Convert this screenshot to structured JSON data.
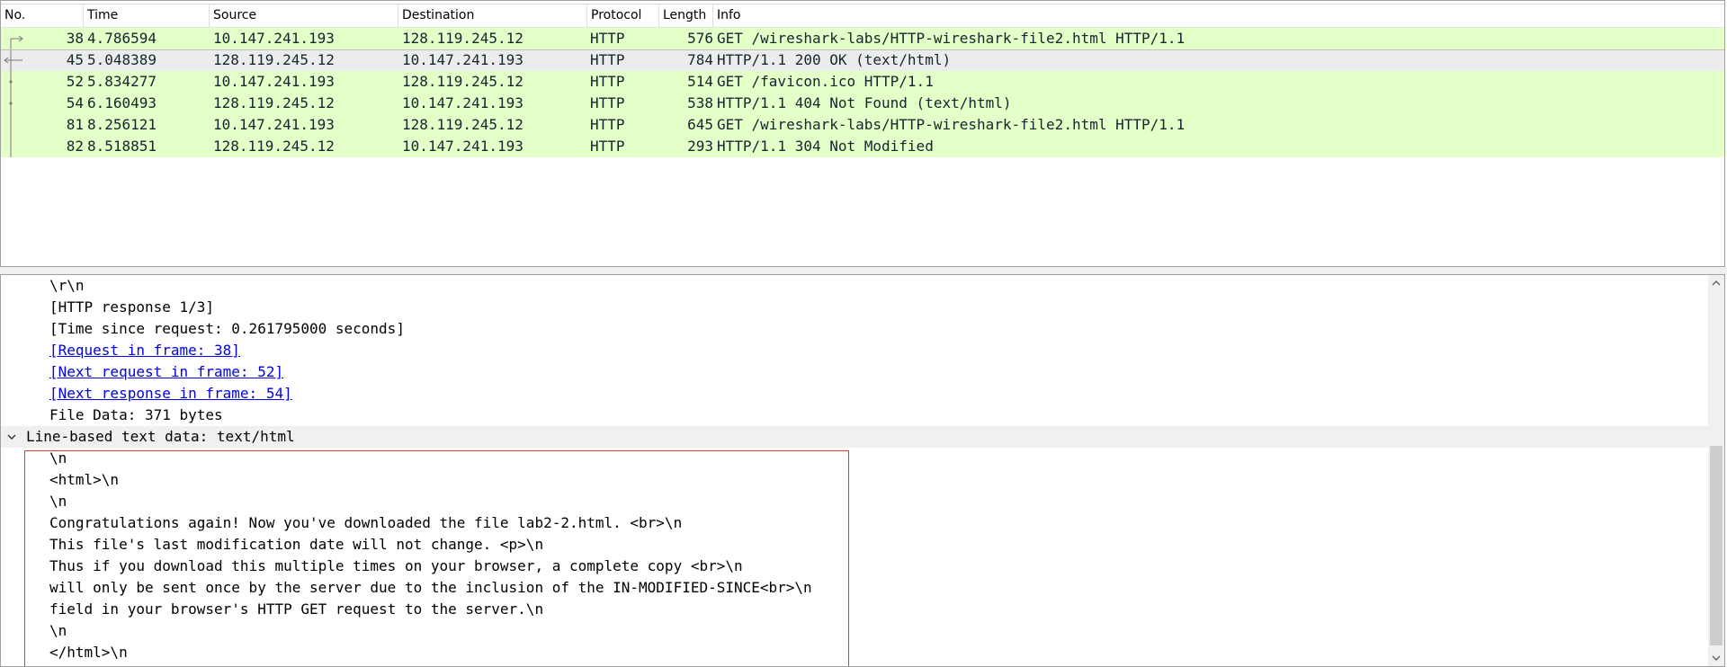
{
  "packet_list": {
    "columns": [
      "No.",
      "Time",
      "Source",
      "Destination",
      "Protocol",
      "Length",
      "Info"
    ],
    "rows": [
      {
        "no": "38",
        "time": "4.786594",
        "src": "10.147.241.193",
        "dst": "128.119.245.12",
        "proto": "HTTP",
        "len": "576",
        "info": "GET /wireshark-labs/HTTP-wireshark-file2.html HTTP/1.1"
      },
      {
        "no": "45",
        "time": "5.048389",
        "src": "128.119.245.12",
        "dst": "10.147.241.193",
        "proto": "HTTP",
        "len": "784",
        "info": "HTTP/1.1 200 OK  (text/html)"
      },
      {
        "no": "52",
        "time": "5.834277",
        "src": "10.147.241.193",
        "dst": "128.119.245.12",
        "proto": "HTTP",
        "len": "514",
        "info": "GET /favicon.ico HTTP/1.1"
      },
      {
        "no": "54",
        "time": "6.160493",
        "src": "128.119.245.12",
        "dst": "10.147.241.193",
        "proto": "HTTP",
        "len": "538",
        "info": "HTTP/1.1 404 Not Found  (text/html)"
      },
      {
        "no": "81",
        "time": "8.256121",
        "src": "10.147.241.193",
        "dst": "128.119.245.12",
        "proto": "HTTP",
        "len": "645",
        "info": "GET /wireshark-labs/HTTP-wireshark-file2.html HTTP/1.1"
      },
      {
        "no": "82",
        "time": "8.518851",
        "src": "128.119.245.12",
        "dst": "10.147.241.193",
        "proto": "HTTP",
        "len": "293",
        "info": "HTTP/1.1 304 Not Modified"
      }
    ],
    "selected_no": "45",
    "row_color": "#e4ffc7"
  },
  "details": {
    "lines_before": [
      {
        "text": "\\r\\n",
        "link": false
      },
      {
        "text": "[HTTP response 1/3]",
        "link": false
      },
      {
        "text": "[Time since request: 0.261795000 seconds]",
        "link": false
      },
      {
        "text": "[Request in frame: 38]",
        "link": true
      },
      {
        "text": "[Next request in frame: 52]",
        "link": true
      },
      {
        "text": "[Next response in frame: 54]",
        "link": true
      },
      {
        "text": "File Data: 371 bytes",
        "link": false
      }
    ],
    "section_title": "Line-based text data: text/html",
    "section_lines": [
      "\\n",
      "<html>\\n",
      "\\n",
      "Congratulations again!  Now you've downloaded the file lab2-2.html. <br>\\n",
      "This file's last modification date will not change.  <p>\\n",
      "Thus  if you download this multiple times on your browser, a complete copy <br>\\n",
      "will only be sent once by the server due to the inclusion of the IN-MODIFIED-SINCE<br>\\n",
      "field in your browser's HTTP GET request to the server.\\n",
      "\\n",
      "</html>\\n"
    ],
    "highlight_color": "#e53935"
  }
}
